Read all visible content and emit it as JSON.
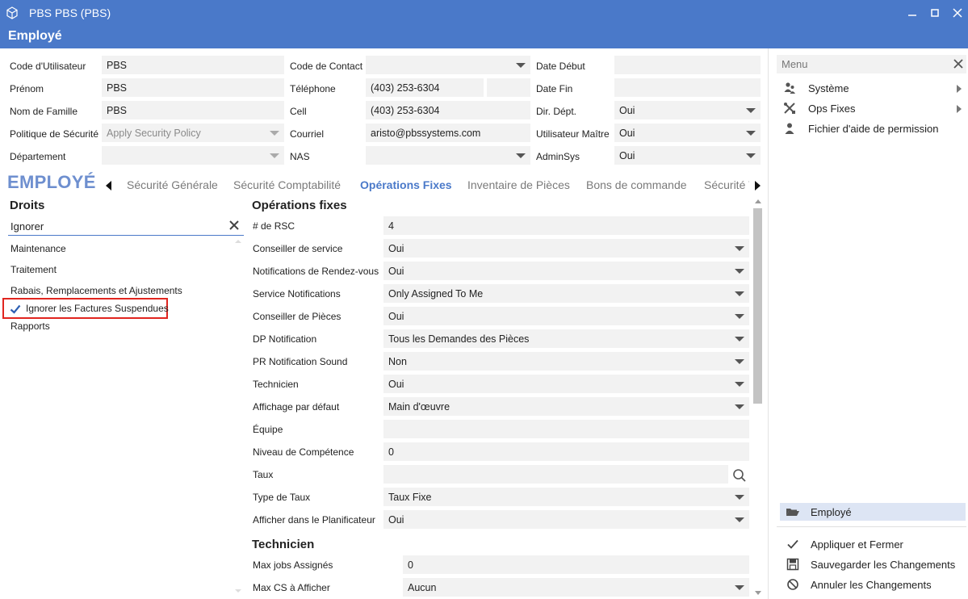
{
  "window": {
    "title": "PBS PBS (PBS)",
    "subtitle": "Employé"
  },
  "form": {
    "col1": [
      {
        "label": "Code d'Utilisateur",
        "value": "PBS"
      },
      {
        "label": "Prénom",
        "value": "PBS"
      },
      {
        "label": "Nom de Famille",
        "value": "PBS"
      },
      {
        "label": "Politique de Sécurité",
        "value": "Apply Security Policy"
      },
      {
        "label": "Département",
        "value": ""
      }
    ],
    "col2": [
      {
        "label": "Code de Contact",
        "value": ""
      },
      {
        "label": "Téléphone",
        "value": "(403) 253-6304",
        "ext": ""
      },
      {
        "label": "Cell",
        "value": "(403) 253-6304"
      },
      {
        "label": "Courriel",
        "value": "aristo@pbssystems.com"
      },
      {
        "label": "NAS",
        "value": ""
      }
    ],
    "col3": [
      {
        "label": "Date Début",
        "value": ""
      },
      {
        "label": "Date Fin",
        "value": ""
      },
      {
        "label": "Dir. Dépt.",
        "value": "Oui"
      },
      {
        "label": "Utilisateur Maître",
        "value": "Oui"
      },
      {
        "label": "AdminSys",
        "value": "Oui"
      }
    ]
  },
  "heading": "EMPLOYÉ",
  "tabs": [
    "Sécurité Générale",
    "Sécurité Comptabilité",
    "Opérations Fixes",
    "Inventaire de Pièces",
    "Bons de commande",
    "Sécurité V"
  ],
  "active_tab": "Opérations Fixes",
  "rights": {
    "title": "Droits",
    "search_value": "Ignorer",
    "items": [
      {
        "label": "Maintenance"
      },
      {
        "label": "Traitement"
      },
      {
        "label": "Rabais, Remplacements et Ajustements"
      },
      {
        "label": "Ignorer les Factures Suspendues",
        "checked": true
      },
      {
        "label": "Rapports"
      }
    ]
  },
  "ops": {
    "title": "Opérations fixes",
    "rows": [
      {
        "label": "# de RSC",
        "value": "4"
      },
      {
        "label": "Conseiller de service",
        "value": "Oui"
      },
      {
        "label": "Notifications de Rendez-vous",
        "value": "Oui"
      },
      {
        "label": "Service Notifications",
        "value": "Only Assigned To Me"
      },
      {
        "label": "Conseiller de Pièces",
        "value": "Oui"
      },
      {
        "label": "DP Notification",
        "value": "Tous les Demandes des Pièces"
      },
      {
        "label": "PR Notification Sound",
        "value": "Non"
      },
      {
        "label": "Technicien",
        "value": "Oui"
      },
      {
        "label": "Affichage par défaut",
        "value": "Main d'œuvre"
      },
      {
        "label": "Équipe",
        "value": ""
      },
      {
        "label": "Niveau de Compétence",
        "value": "0"
      },
      {
        "label": "Taux",
        "value": ""
      },
      {
        "label": "Type de Taux",
        "value": "Taux Fixe"
      },
      {
        "label": "Afficher dans le Planificateur",
        "value": "Oui"
      }
    ],
    "tech_title": "Technicien",
    "tech_rows": [
      {
        "label": "Max jobs Assignés",
        "value": "0"
      },
      {
        "label": "Max CS à Afficher",
        "value": "Aucun"
      }
    ]
  },
  "menu": {
    "title": "Menu",
    "items": [
      {
        "label": "Système",
        "icon": "users-icon"
      },
      {
        "label": "Ops Fixes",
        "icon": "tools-icon"
      },
      {
        "label": "Fichier d'aide de permission",
        "icon": "user-icon"
      }
    ],
    "nav": "Employé",
    "actions": [
      {
        "label": "Appliquer et Fermer",
        "icon": "check-icon"
      },
      {
        "label": "Sauvegarder les Changements",
        "icon": "save-icon"
      },
      {
        "label": "Annuler les Changements",
        "icon": "cancel-icon"
      }
    ]
  },
  "colors": {
    "titlebar": "#4a79c9",
    "accent": "#4a79c9",
    "highlight": "#e0251f"
  }
}
